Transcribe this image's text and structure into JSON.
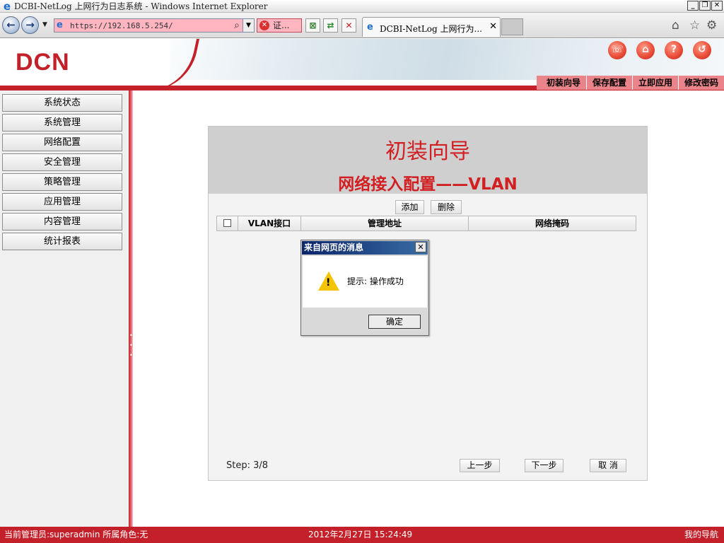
{
  "window": {
    "title": "DCBI-NetLog 上网行为日志系统 - Windows Internet Explorer",
    "buttons": [
      "_",
      "❐",
      "✕"
    ]
  },
  "browser": {
    "url": "https://192.168.5.254/",
    "cert_label": "证...",
    "tab_label": "DCBI-NetLog 上网行为...",
    "tab_close": "✕"
  },
  "header": {
    "logo": "DCN",
    "top_menu": [
      "初装向导",
      "保存配置",
      "立即应用",
      "修改密码"
    ]
  },
  "sidebar": {
    "items": [
      "系统状态",
      "系统管理",
      "网络配置",
      "安全管理",
      "策略管理",
      "应用管理",
      "内容管理",
      "统计报表"
    ]
  },
  "wizard": {
    "title": "初装向导",
    "subtitle": "网络接入配置——VLAN",
    "add_label": "添加",
    "delete_label": "删除",
    "columns": [
      "VLAN接口",
      "管理地址",
      "网络掩码"
    ],
    "step": "Step: 3/8",
    "prev_label": "上一步",
    "next_label": "下一步",
    "cancel_label": "取 消"
  },
  "dialog": {
    "title": "来自网页的消息",
    "message": "提示: 操作成功",
    "ok_label": "确定"
  },
  "status": {
    "admin": "当前管理员:superadmin  所属角色:无",
    "datetime": "2012年2月27日 15:24:49",
    "nav": "我的导航"
  }
}
